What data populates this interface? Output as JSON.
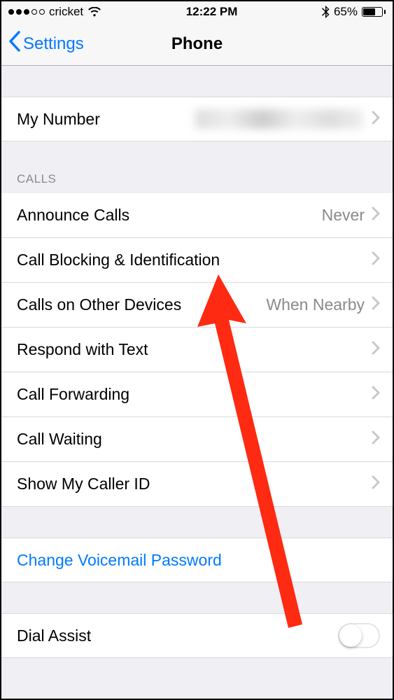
{
  "statusBar": {
    "carrier": "cricket",
    "time": "12:22 PM",
    "batteryPercent": "65%"
  },
  "nav": {
    "back": "Settings",
    "title": "Phone"
  },
  "myNumber": {
    "label": "My Number"
  },
  "callsHeader": "CALLS",
  "calls": {
    "announce": {
      "label": "Announce Calls",
      "value": "Never"
    },
    "blocking": {
      "label": "Call Blocking & Identification"
    },
    "otherDevices": {
      "label": "Calls on Other Devices",
      "value": "When Nearby"
    },
    "respondText": {
      "label": "Respond with Text"
    },
    "forwarding": {
      "label": "Call Forwarding"
    },
    "waiting": {
      "label": "Call Waiting"
    },
    "callerId": {
      "label": "Show My Caller ID"
    }
  },
  "voicemail": {
    "label": "Change Voicemail Password"
  },
  "dialAssist": {
    "label": "Dial Assist"
  }
}
